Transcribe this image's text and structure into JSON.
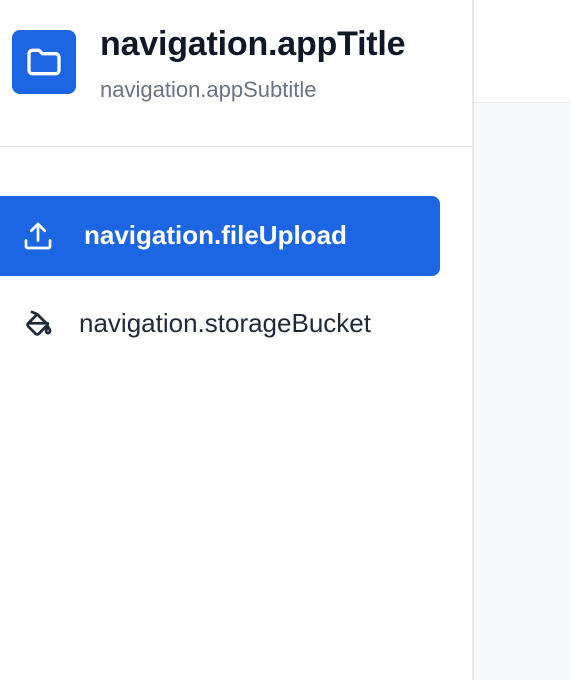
{
  "navigation": {
    "appTitle": "navigation.appTitle",
    "appSubtitle": "navigation.appSubtitle",
    "logo_icon": "folder-icon",
    "items": [
      {
        "label": "navigation.fileUpload",
        "icon": "upload-icon",
        "active": true
      },
      {
        "label": "navigation.storageBucket",
        "icon": "paint-bucket-icon",
        "active": false
      }
    ]
  },
  "colors": {
    "accent": "#1c66e3",
    "title": "#101828",
    "subtitle": "#6b7280",
    "nav_text": "#1f2937",
    "content_bg": "#f7f8fa",
    "border": "#e5e7eb"
  }
}
